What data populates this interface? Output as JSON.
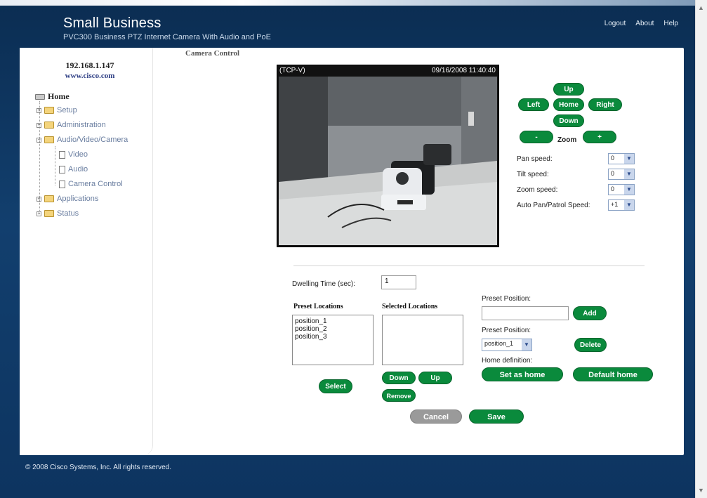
{
  "header": {
    "brand": "Small Business",
    "subtitle": "PVC300 Business PTZ Internet Camera With Audio and PoE",
    "links": [
      "Logout",
      "About",
      "Help"
    ]
  },
  "sidebar": {
    "ip": "192.168.1.147",
    "site": "www.cisco.com",
    "tree": {
      "home": "Home",
      "setup": "Setup",
      "administration": "Administration",
      "avc": "Audio/Video/Camera",
      "video": "Video",
      "audio": "Audio",
      "camera_control": "Camera Control",
      "applications": "Applications",
      "status": "Status"
    }
  },
  "main": {
    "title": "Camera Control",
    "camera": {
      "mode": "(TCP-V)",
      "timestamp": "09/16/2008 11:40:40"
    },
    "ptz": {
      "up": "Up",
      "left": "Left",
      "home": "Home",
      "right": "Right",
      "down": "Down",
      "zoom_minus": "-",
      "zoom_plus": "+",
      "zoom_label": "Zoom"
    },
    "speeds": {
      "pan_label": "Pan speed:",
      "pan_value": "0",
      "tilt_label": "Tilt speed:",
      "tilt_value": "0",
      "zoom_label": "Zoom speed:",
      "zoom_value": "0",
      "auto_label": "Auto Pan/Patrol Speed:",
      "auto_value": "+1"
    },
    "patrol": {
      "dwelling_label": "Dwelling Time (sec):",
      "dwelling_value": "1",
      "preset_locations_label": "Preset Locations",
      "preset_locations": [
        "position_1",
        "position_2",
        "position_3"
      ],
      "selected_locations_label": "Selected Locations",
      "preset_position_label": "Preset Position:",
      "preset_position_input": "",
      "add": "Add",
      "preset_position_label2": "Preset Position:",
      "preset_select_value": "position_1",
      "delete": "Delete",
      "home_definition": "Home definition:",
      "set_as_home": "Set as home",
      "default_home": "Default home",
      "select": "Select",
      "down": "Down",
      "up": "Up",
      "remove": "Remove"
    },
    "actions": {
      "cancel": "Cancel",
      "save": "Save"
    }
  },
  "footer": {
    "copyright": "© 2008 Cisco Systems, Inc. All rights reserved."
  }
}
